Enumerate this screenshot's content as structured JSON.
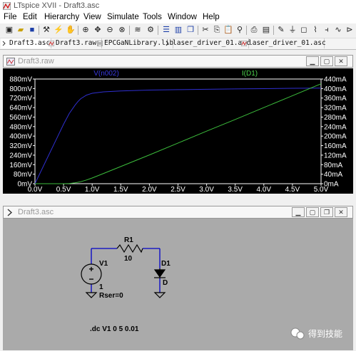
{
  "window": {
    "title": "LTspice XVII - Draft3.asc"
  },
  "menu": [
    "File",
    "Edit",
    "Hierarchy",
    "View",
    "Simulate",
    "Tools",
    "Window",
    "Help"
  ],
  "tabs": [
    "Draft3.asc",
    "Draft3.raw",
    "EPCGaNLibrary.lib",
    "laser_driver_01.asc",
    "laser_driver_01.asc"
  ],
  "plot_window": {
    "title": "Draft3.raw",
    "trace_left_label": "V(n002)",
    "trace_right_label": "I(D1)",
    "colors": {
      "voltage": "#2f2fd0",
      "current": "#3cbd3c",
      "axis": "#ffffff"
    }
  },
  "schematic_window": {
    "title": "Draft3.asc",
    "r1_name": "R1",
    "r1_value": "10",
    "v1_name": "V1",
    "v1_value": "1",
    "v1_rser": "Rser=0",
    "d1_name": "D1",
    "d1_value": "D",
    "directive": ".dc V1 0 5 0.01",
    "watermark": "得到技能"
  },
  "chart_data": {
    "type": "line",
    "x": [
      0,
      0.2,
      0.4,
      0.5,
      0.6,
      0.7,
      0.75,
      0.8,
      0.9,
      1.0,
      1.2,
      1.5,
      2.0,
      2.5,
      3.0,
      3.5,
      4.0,
      4.5,
      5.0
    ],
    "series": [
      {
        "name": "V(n002)",
        "axis": "left",
        "unit": "mV",
        "values": [
          0,
          200,
          400,
          500,
          590,
          660,
          690,
          715,
          745,
          760,
          772,
          780,
          787,
          791,
          794,
          797,
          799,
          802,
          804
        ]
      },
      {
        "name": "I(D1)",
        "axis": "right",
        "unit": "mA",
        "values": [
          0,
          0,
          0,
          0,
          0.5,
          4,
          6,
          8.5,
          15.5,
          24,
          43,
          72,
          121,
          171,
          221,
          270,
          320,
          370,
          420
        ]
      }
    ],
    "xlim": [
      0,
      5
    ],
    "ylim_left": [
      0,
      880
    ],
    "ylim_right": [
      0,
      440
    ],
    "x_ticks": [
      "0.0V",
      "0.5V",
      "1.0V",
      "1.5V",
      "2.0V",
      "2.5V",
      "3.0V",
      "3.5V",
      "4.0V",
      "4.5V",
      "5.0V"
    ],
    "y_left_ticks": [
      "0mV",
      "80mV",
      "160mV",
      "240mV",
      "320mV",
      "400mV",
      "480mV",
      "560mV",
      "640mV",
      "720mV",
      "800mV",
      "880mV"
    ],
    "y_right_ticks": [
      "0mA",
      "40mA",
      "80mA",
      "120mA",
      "160mA",
      "200mA",
      "240mA",
      "280mA",
      "320mA",
      "360mA",
      "400mA",
      "440mA"
    ],
    "grid": false
  }
}
